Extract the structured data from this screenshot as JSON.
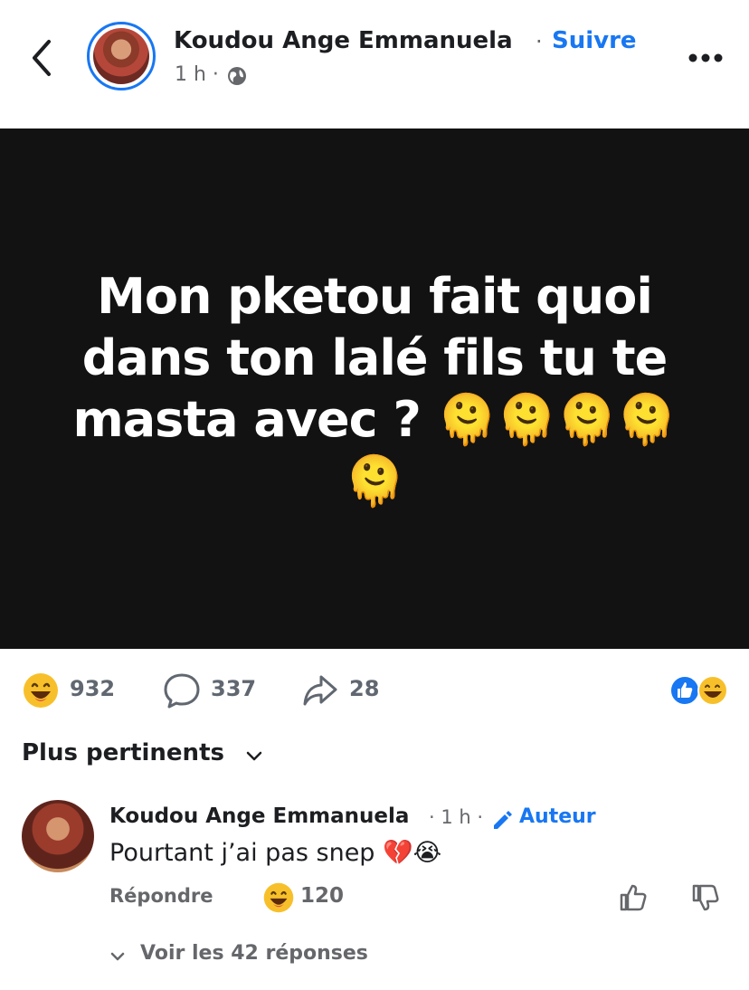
{
  "header": {
    "author_name": "Koudou Ange Emmanuela",
    "separator": "·",
    "follow_label": "Suivre",
    "post_time": "1 h ·",
    "accent_color": "#1877f2"
  },
  "post": {
    "text": "Mon pketou fait quoi dans ton lalé fils tu te masta avec ? 🫠🫠🫠🫠🫠",
    "background": "#121212"
  },
  "stats": {
    "reactions_count": "932",
    "comments_count": "337",
    "shares_count": "28",
    "reaction_icons": [
      "like-icon",
      "laugh-emoji-icon"
    ]
  },
  "sort": {
    "label": "Plus pertinents"
  },
  "comment": {
    "author": "Koudou Ange Emmanuela",
    "time": "· 1 h ·",
    "badge": "Auteur",
    "text": "Pourtant j’ai pas snep 💔😭",
    "reply_label": "Répondre",
    "reaction_count": "120",
    "view_replies_label": "Voir les 42 réponses"
  }
}
